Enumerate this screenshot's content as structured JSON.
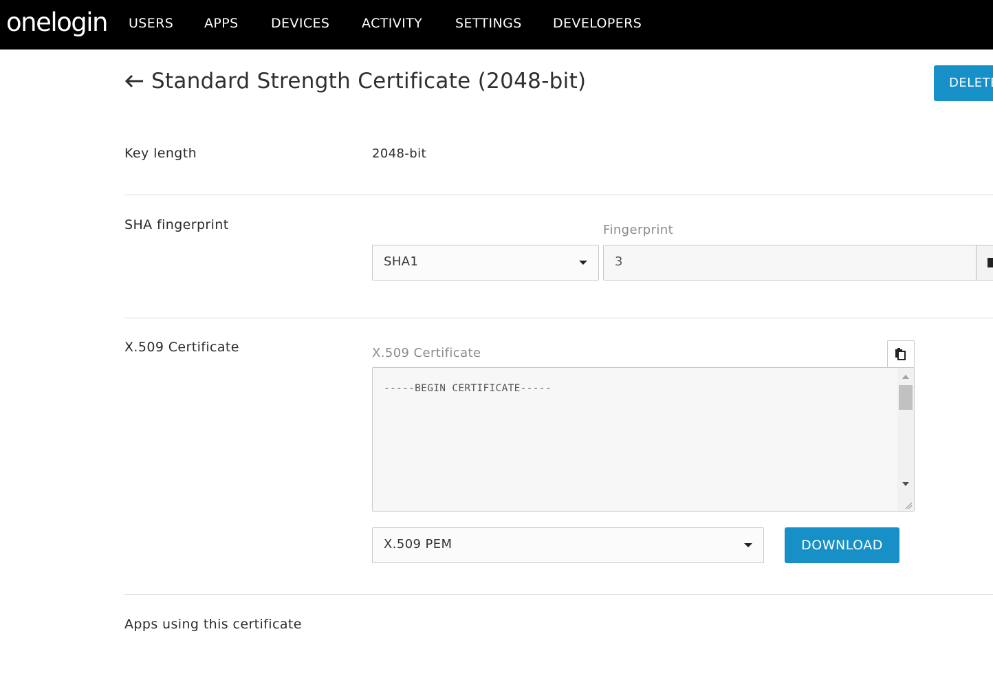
{
  "header": {
    "logo": "onelogin",
    "nav": [
      "USERS",
      "APPS",
      "DEVICES",
      "ACTIVITY",
      "SETTINGS",
      "DEVELOPERS"
    ]
  },
  "page": {
    "title": "Standard Strength Certificate (2048-bit)",
    "delete_label": "DELETE"
  },
  "key_length": {
    "label": "Key length",
    "value": "2048-bit"
  },
  "sha": {
    "label": "SHA fingerprint",
    "algorithm": "SHA1",
    "fingerprint_label": "Fingerprint",
    "fingerprint_value": "3"
  },
  "x509": {
    "label": "X.509 Certificate",
    "field_label": "X.509 Certificate",
    "content": "-----BEGIN CERTIFICATE-----",
    "format": "X.509 PEM",
    "download_label": "DOWNLOAD"
  },
  "apps": {
    "label": "Apps using this certificate"
  },
  "colors": {
    "accent": "#1790c8",
    "topbar": "#000000"
  }
}
